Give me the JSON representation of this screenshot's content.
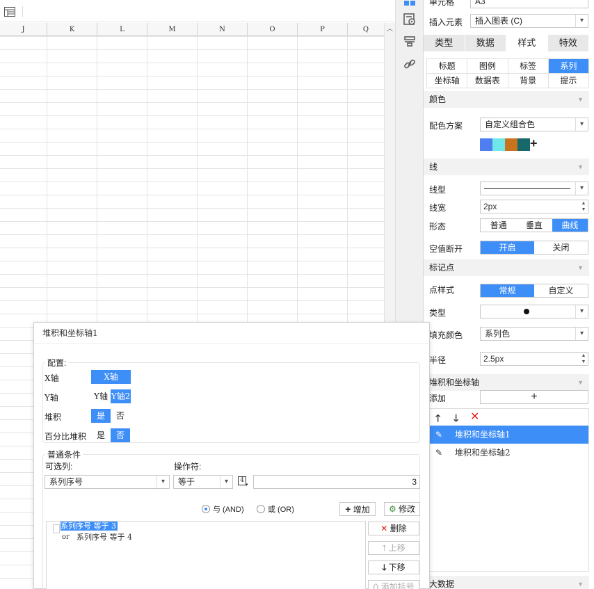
{
  "spreadsheet": {
    "columns": [
      "J",
      "K",
      "L",
      "M",
      "N",
      "O",
      "P",
      "Q"
    ]
  },
  "panel": {
    "cell_label": "单元格",
    "cell_value": "A3",
    "insert_label": "插入元素",
    "insert_value": "插入图表 (C)",
    "main_tabs": [
      "类型",
      "数据",
      "样式",
      "特效"
    ],
    "sub_tabs": [
      "标题",
      "图例",
      "标签",
      "系列",
      "坐标轴",
      "数据表",
      "背景",
      "提示"
    ],
    "color_section": "颜色",
    "color_scheme_label": "配色方案",
    "color_scheme_value": "自定义组合色",
    "swatch_colors": [
      "#4f7ef0",
      "#6fe6ea",
      "#c8741e",
      "#17686a"
    ],
    "line_section": "线",
    "line_type_label": "线型",
    "line_width_label": "线宽",
    "line_width_value": "2px",
    "shape_label": "形态",
    "shape_options": [
      "普通",
      "垂直",
      "曲线"
    ],
    "null_break_label": "空值断开",
    "null_break_options": [
      "开启",
      "关闭"
    ],
    "marker_section": "标记点",
    "marker_style_label": "点样式",
    "marker_style_options": [
      "常规",
      "自定义"
    ],
    "marker_type_label": "类型",
    "fill_color_label": "填充颜色",
    "fill_color_value": "系列色",
    "radius_label": "半径",
    "radius_value": "2.5px",
    "stack_section": "堆积和坐标轴",
    "add_label": "添加",
    "stack_items": [
      "堆积和坐标轴1",
      "堆积和坐标轴2"
    ],
    "bigdata_section": "大数据"
  },
  "dialog": {
    "title": "堆积和坐标轴1",
    "config_legend": "配置:",
    "x_axis_label": "X轴",
    "x_axis_option": "X轴",
    "y_axis_label": "Y轴",
    "y_axis_options": [
      "Y轴",
      "Y轴2"
    ],
    "stack_label": "堆积",
    "stack_options": [
      "是",
      "否"
    ],
    "percent_label": "百分比堆积",
    "percent_options": [
      "是",
      "否"
    ],
    "cond_legend": "普通条件",
    "columns_label": "可选列:",
    "columns_value": "系列序号",
    "operator_label": "操作符:",
    "operator_value": "等于",
    "value_type": "4",
    "value": "3",
    "and_label": "与 (AND)",
    "or_label": "或 (OR)",
    "add_btn": "增加",
    "modify_btn": "修改",
    "delete_btn": "删除",
    "up_btn": "上移",
    "down_btn": "下移",
    "bracket_btn": "添加括号",
    "cond1": "系列序号 等于 3",
    "cond2_prefix": "or",
    "cond2": "系列序号 等于 4"
  }
}
